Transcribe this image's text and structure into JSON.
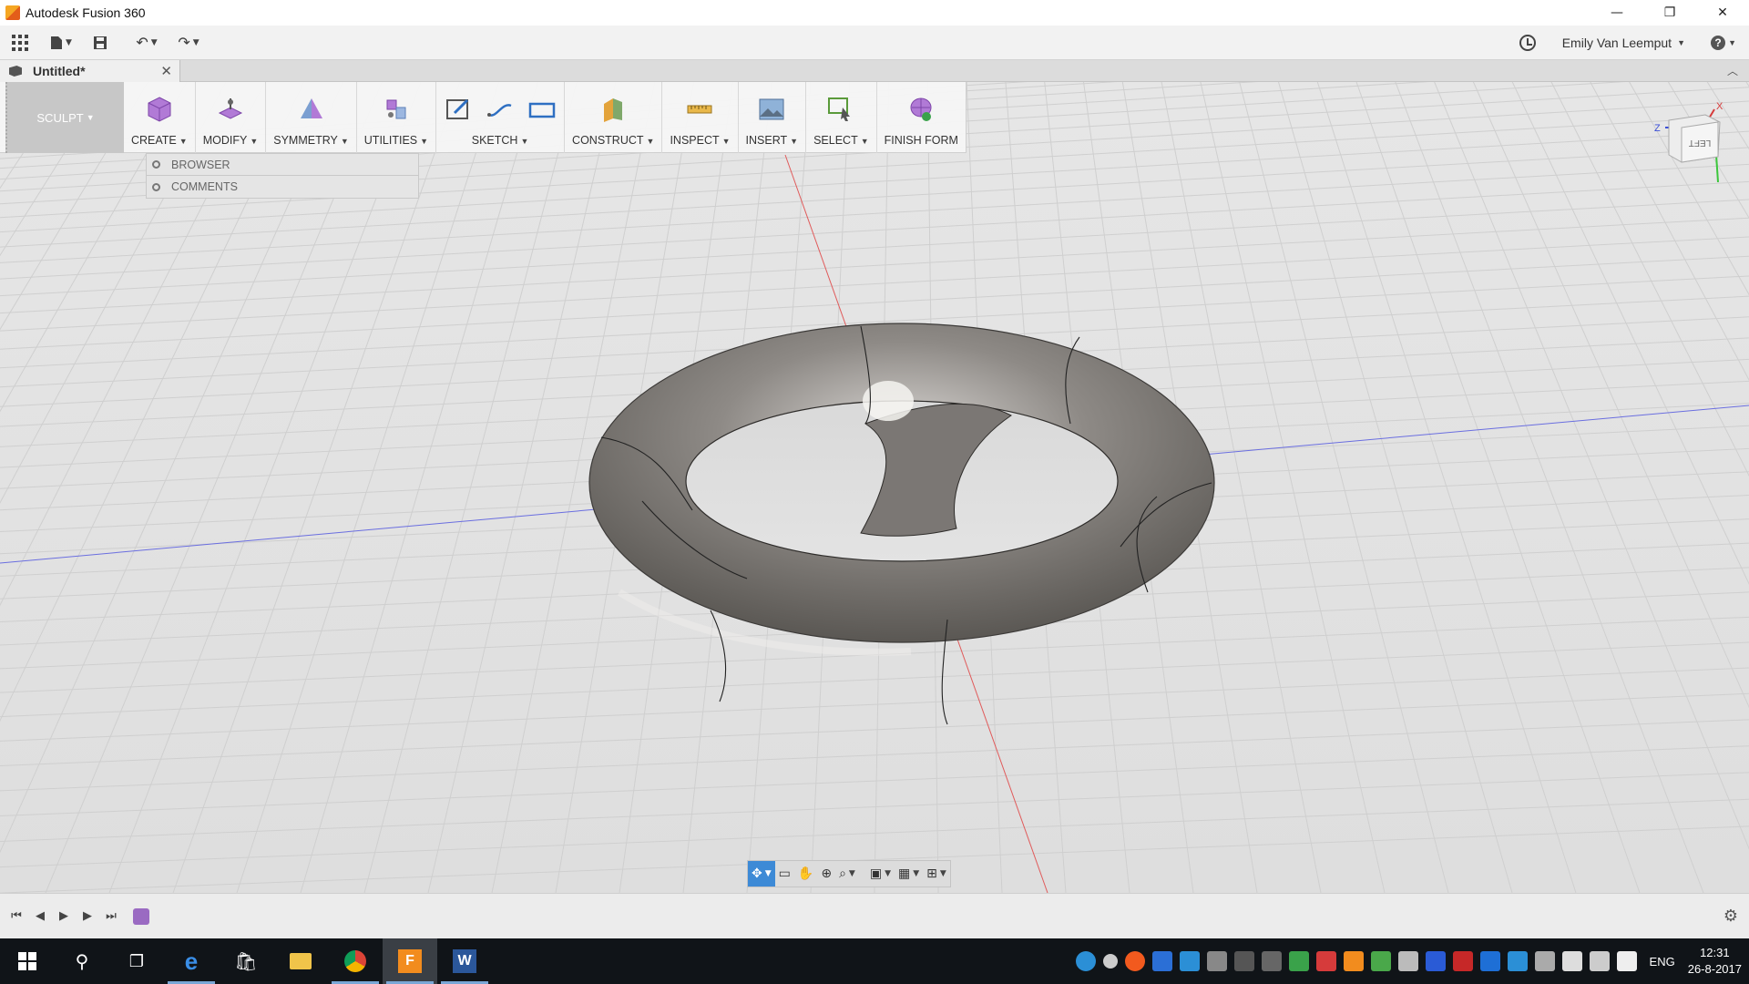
{
  "window": {
    "title": "Autodesk Fusion 360",
    "controls": {
      "minimize": "—",
      "restore": "❐",
      "close": "✕"
    }
  },
  "quick_access": {
    "user_name": "Emily Van Leemput",
    "help_glyph": "?"
  },
  "document_tab": {
    "name": "Untitled*",
    "close_glyph": "✕"
  },
  "workspace": {
    "label": "SCULPT"
  },
  "toolbar": {
    "groups": [
      {
        "label": "CREATE",
        "icon": "create-box-icon"
      },
      {
        "label": "MODIFY",
        "icon": "modify-icon"
      },
      {
        "label": "SYMMETRY",
        "icon": "symmetry-icon"
      },
      {
        "label": "UTILITIES",
        "icon": "utilities-icon"
      },
      {
        "label": "SKETCH",
        "icon": "sketch-icon"
      },
      {
        "label": "CONSTRUCT",
        "icon": "construct-plane-icon"
      },
      {
        "label": "INSPECT",
        "icon": "measure-icon"
      },
      {
        "label": "INSERT",
        "icon": "insert-image-icon"
      },
      {
        "label": "SELECT",
        "icon": "select-icon"
      },
      {
        "label": "FINISH FORM",
        "icon": "finish-form-icon"
      }
    ]
  },
  "panels": {
    "browser": "BROWSER",
    "comments": "COMMENTS"
  },
  "viewcube": {
    "face": "LEFT",
    "axis_x": "X",
    "axis_z": "Z"
  },
  "taskbar": {
    "language": "ENG",
    "time": "12:31",
    "date": "26-8-2017"
  },
  "colors": {
    "accent": "#3d8ad6",
    "workspace_bg": "#c7c7c7",
    "taskbar_bg": "#101418",
    "model_gray": "#8a8784"
  }
}
